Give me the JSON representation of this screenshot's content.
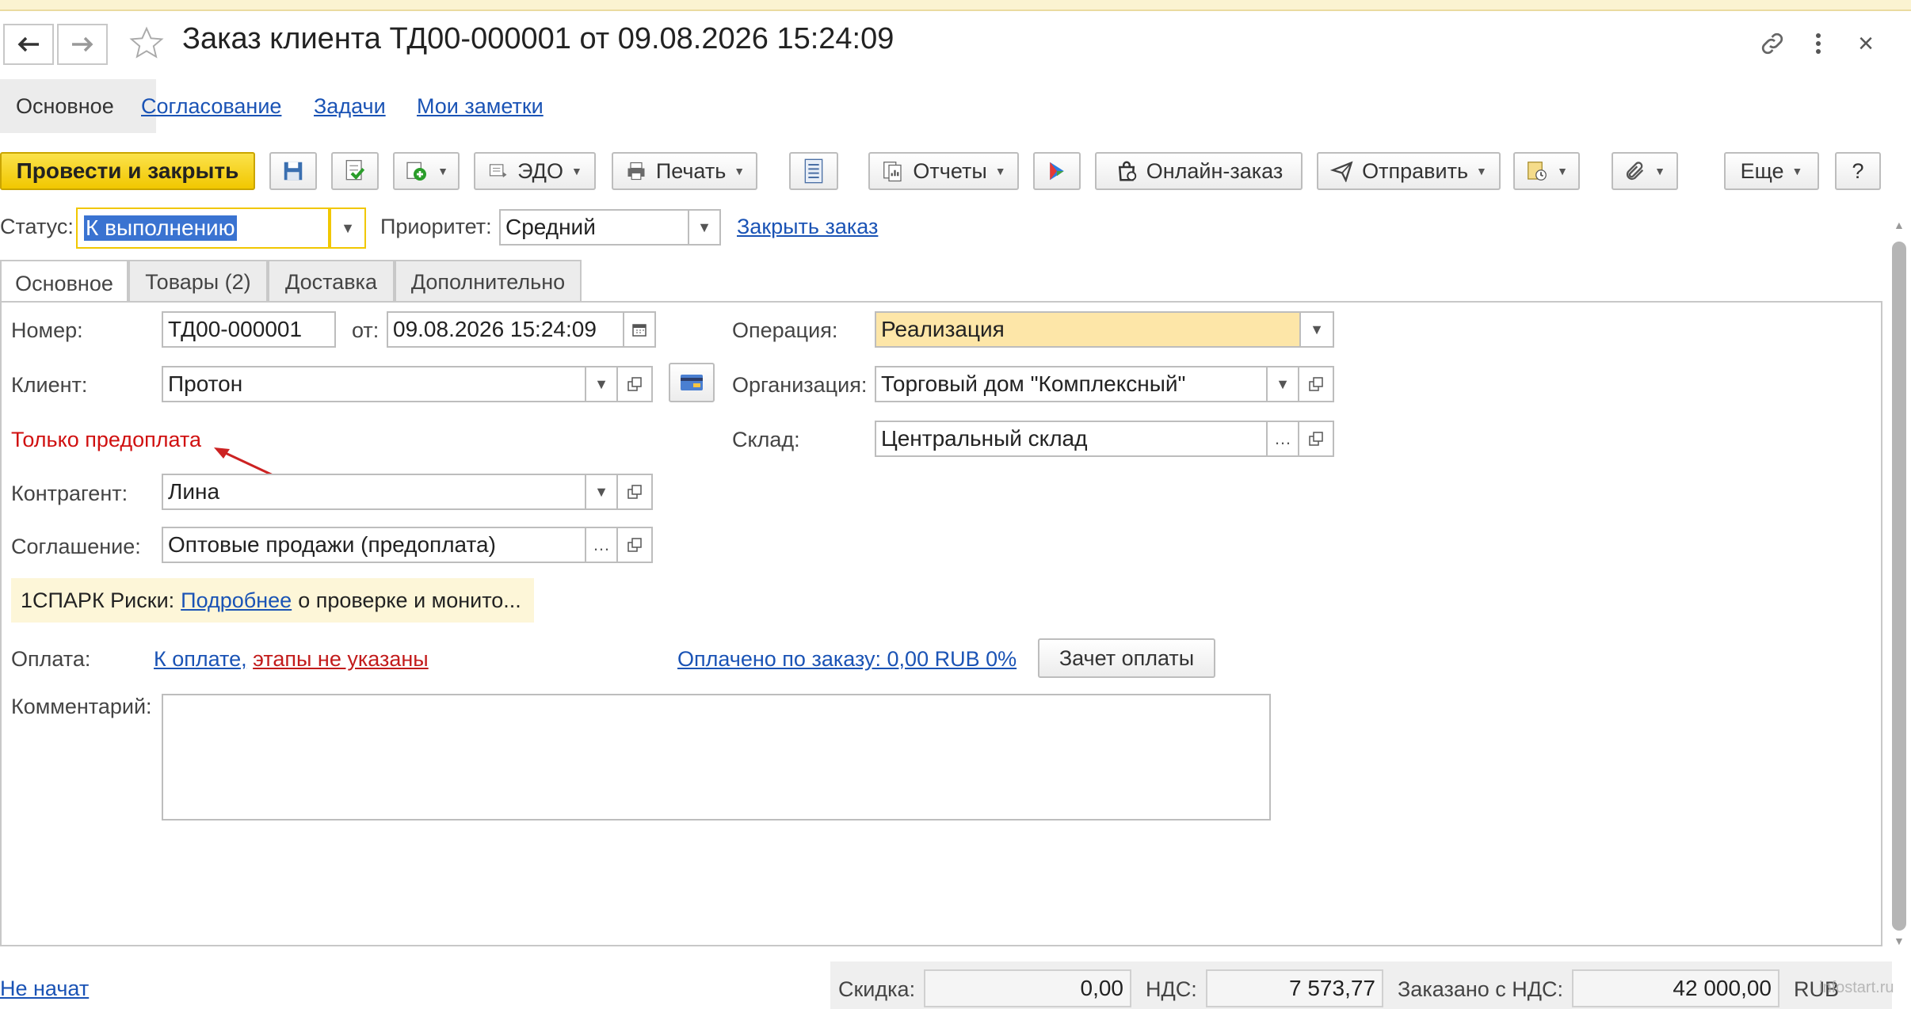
{
  "window": {
    "title": "Заказ клиента ТД00-000001 от 09.08.2026 15:24:09",
    "close_glyph": "×"
  },
  "top_tabs": [
    "Основное",
    "Согласование",
    "Задачи",
    "Мои заметки"
  ],
  "toolbar": {
    "post_close": "Провести и закрыть",
    "edo": "ЭДО",
    "print": "Печать",
    "reports": "Отчеты",
    "online_order": "Онлайн-заказ",
    "send": "Отправить",
    "more": "Еще",
    "help": "?"
  },
  "status": {
    "label": "Статус:",
    "value": "К выполнению",
    "priority_label": "Приоритет:",
    "priority_value": "Средний",
    "close_order_link": "Закрыть заказ"
  },
  "form_tabs": [
    "Основное",
    "Товары (2)",
    "Доставка",
    "Дополнительно"
  ],
  "form": {
    "number_label": "Номер:",
    "number_value": "ТД00-000001",
    "date_label": "от:",
    "date_value": "09.08.2026 15:24:09",
    "client_label": "Клиент:",
    "client_value": "Протон",
    "prepay_warning": "Только предоплата",
    "contractor_label": "Контрагент:",
    "contractor_value": "Лина",
    "agreement_label": "Соглашение:",
    "agreement_value": "Оптовые продажи (предоплата)",
    "operation_label": "Операция:",
    "operation_value": "Реализация",
    "org_label": "Организация:",
    "org_value": "Торговый дом \"Комплексный\"",
    "warehouse_label": "Склад:",
    "warehouse_value": "Центральный склад",
    "spark_prefix": "1СПАРК Риски:",
    "spark_link": "Подробнее",
    "spark_suffix": "о проверке и монито...",
    "payment_label": "Оплата:",
    "payment_link_part1": "К оплате,",
    "payment_link_part2": "этапы не указаны",
    "paid_link": "Оплачено по заказу: 0,00 RUB 0%",
    "offset_button": "Зачет оплаты",
    "comment_label": "Комментарий:",
    "comment_value": ""
  },
  "footer": {
    "status_link": "Не начат",
    "discount_label": "Скидка:",
    "discount_value": "0,00",
    "vat_label": "НДС:",
    "vat_value": "7 573,77",
    "ordered_label": "Заказано с НДС:",
    "ordered_value": "42 000,00",
    "currency": "RUB",
    "watermark": "infostart.ru"
  },
  "colors": {
    "accent_yellow": "#f1c700",
    "link_blue": "#1a53b5",
    "warning_red": "#d01010",
    "operation_bg": "#fde6a8",
    "spark_bg": "#fdf6d8"
  }
}
